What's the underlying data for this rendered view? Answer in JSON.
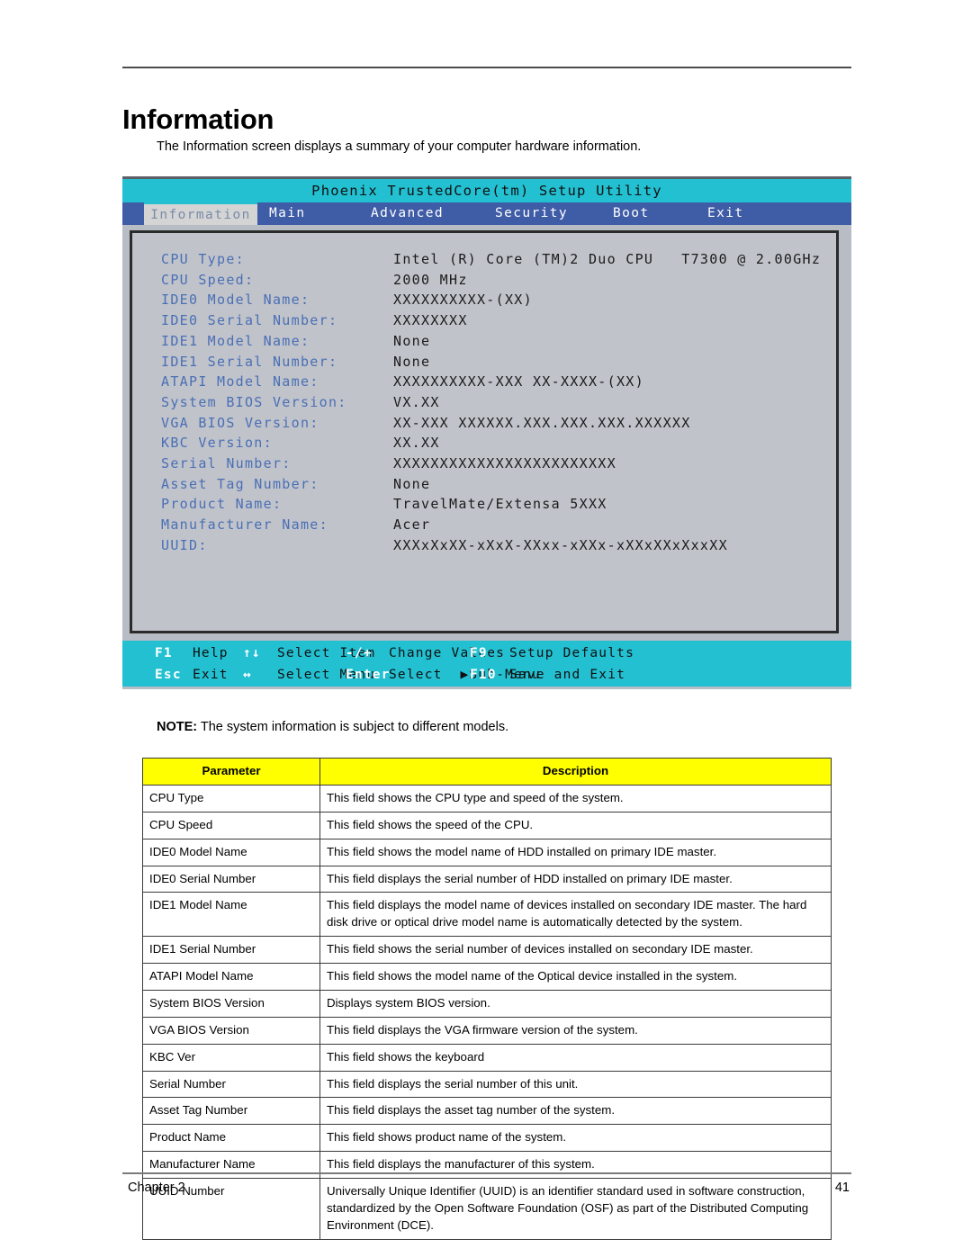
{
  "document": {
    "page_title": "Information",
    "intro": "The Information screen displays a summary of your computer hardware information.",
    "note_prefix": "NOTE:",
    "note_text": " The system information is subject to different models.",
    "chapter": "Chapter 2",
    "page_number": "41"
  },
  "bios": {
    "title": "Phoenix TrustedCore(tm) Setup Utility",
    "tabs": [
      {
        "label": "Information",
        "active": true
      },
      {
        "label": "Main",
        "active": false
      },
      {
        "label": "Advanced",
        "active": false
      },
      {
        "label": "Security",
        "active": false
      },
      {
        "label": "Boot",
        "active": false
      },
      {
        "label": "Exit",
        "active": false
      }
    ],
    "fields": [
      {
        "label": "CPU Type:",
        "value": "Intel (R) Core (TM)2 Duo CPU   T7300 @ 2.00GHz"
      },
      {
        "label": "CPU Speed:",
        "value": "2000 MHz"
      },
      {
        "label": "IDE0 Model Name:",
        "value": "XXXXXXXXXX-(XX)"
      },
      {
        "label": "IDE0 Serial Number:",
        "value": "XXXXXXXX"
      },
      {
        "label": "IDE1 Model Name:",
        "value": "None"
      },
      {
        "label": "IDE1 Serial Number:",
        "value": "None"
      },
      {
        "label": "ATAPI Model Name:",
        "value": "XXXXXXXXXX-XXX XX-XXXX-(XX)"
      },
      {
        "label": "System BIOS Version:",
        "value": "VX.XX"
      },
      {
        "label": "VGA BIOS Version:",
        "value": "XX-XXX XXXXXX.XXX.XXX.XXX.XXXXXX"
      },
      {
        "label": "KBC Version:",
        "value": "XX.XX"
      },
      {
        "label": "Serial Number:",
        "value": "XXXXXXXXXXXXXXXXXXXXXXXX"
      },
      {
        "label": "Asset Tag Number:",
        "value": "None"
      },
      {
        "label": "Product Name:",
        "value": "TravelMate/Extensa 5XXX"
      },
      {
        "label": "Manufacturer Name:",
        "value": "Acer"
      },
      {
        "label": "UUID:",
        "value": "XXXxXxXX-xXxX-XXxx-xXXx-xXXxXXxXxxXX"
      }
    ],
    "footer": {
      "row1": [
        {
          "key": "F1",
          "label": "Help"
        },
        {
          "key": "↑↓",
          "label": "Select Item"
        },
        {
          "key": "-/+",
          "label": "Change Values"
        },
        {
          "key": "F9",
          "label": "Setup Defaults"
        }
      ],
      "row2": [
        {
          "key": "Esc",
          "label": "Exit"
        },
        {
          "key": "↔",
          "label": "Select Menu"
        },
        {
          "key": "Enter",
          "label": "Select  ▶Sub-Menu"
        },
        {
          "key": "F10",
          "label": "Save and Exit"
        }
      ]
    }
  },
  "table": {
    "headers": [
      "Parameter",
      "Description"
    ],
    "rows": [
      [
        "CPU Type",
        "This field shows the CPU type and speed of the system."
      ],
      [
        "CPU Speed",
        "This field shows the speed of the CPU."
      ],
      [
        "IDE0 Model Name",
        "This field shows the model name of HDD installed on primary IDE master."
      ],
      [
        "IDE0 Serial Number",
        "This field displays the serial number of HDD installed on primary IDE master."
      ],
      [
        "IDE1 Model Name",
        "This field displays the model name of devices installed on secondary IDE master. The hard disk drive or optical drive model name is automatically detected by the system."
      ],
      [
        "IDE1 Serial Number",
        "This field shows the serial number of devices installed on secondary IDE master."
      ],
      [
        "ATAPI Model Name",
        "This field shows the model name of the Optical device installed in the system."
      ],
      [
        "System BIOS Version",
        "Displays system BIOS version."
      ],
      [
        "VGA BIOS Version",
        "This field displays the VGA firmware version of the system."
      ],
      [
        "KBC Ver",
        "This field shows the keyboard"
      ],
      [
        "Serial Number",
        "This field displays the serial number of this unit."
      ],
      [
        "Asset Tag Number",
        "This field displays the asset tag number of the system."
      ],
      [
        "Product Name",
        "This field shows product name of the system."
      ],
      [
        "Manufacturer Name",
        "This field displays the manufacturer of this system."
      ],
      [
        "UUID Number",
        "Universally Unique Identifier (UUID) is an identifier standard used in software construction, standardized by the Open Software Foundation (OSF) as part of the Distributed Computing Environment (DCE)."
      ]
    ]
  },
  "colors": {
    "bios_title_bar": "#23c0d2",
    "bios_menu_bar": "#3f5ca6",
    "bios_body": "#c0c3ca",
    "bios_label": "#4a6fb5",
    "table_header": "#ffff00"
  }
}
